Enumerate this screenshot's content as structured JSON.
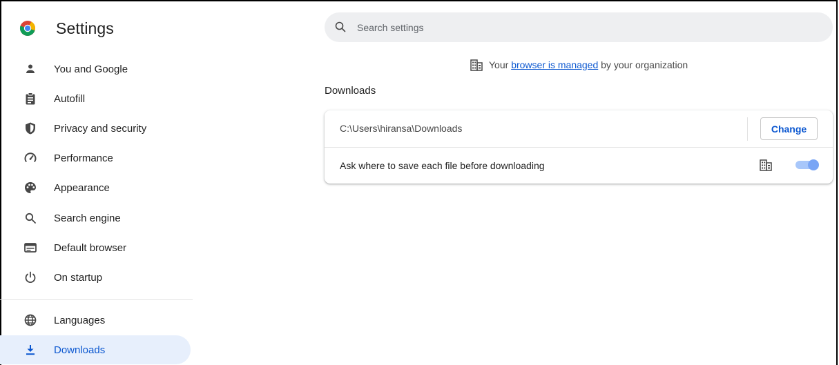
{
  "app": {
    "title": "Settings"
  },
  "sidebar": {
    "items": [
      {
        "label": "You and Google",
        "icon": "person-icon"
      },
      {
        "label": "Autofill",
        "icon": "clipboard-icon"
      },
      {
        "label": "Privacy and security",
        "icon": "shield-icon"
      },
      {
        "label": "Performance",
        "icon": "speedometer-icon"
      },
      {
        "label": "Appearance",
        "icon": "palette-icon"
      },
      {
        "label": "Search engine",
        "icon": "search-icon"
      },
      {
        "label": "Default browser",
        "icon": "browser-window-icon"
      },
      {
        "label": "On startup",
        "icon": "power-icon"
      },
      {
        "label": "Languages",
        "icon": "globe-icon"
      },
      {
        "label": "Downloads",
        "icon": "download-icon",
        "selected": true
      }
    ]
  },
  "search": {
    "placeholder": "Search settings",
    "value": ""
  },
  "managed_notice": {
    "prefix": "Your ",
    "link": "browser is managed",
    "suffix": " by your organization"
  },
  "downloads": {
    "section_title": "Downloads",
    "location_path": "C:\\Users\\hiransa\\Downloads",
    "change_label": "Change",
    "ask_label": "Ask where to save each file before downloading",
    "ask_enabled": true,
    "ask_policy_managed": true
  },
  "colors": {
    "accent": "#0b57d0",
    "selected_bg": "#e7effc",
    "search_bg": "#eeeff1",
    "toggle_track": "#a8c7fa",
    "toggle_knob": "#79a5f5"
  }
}
